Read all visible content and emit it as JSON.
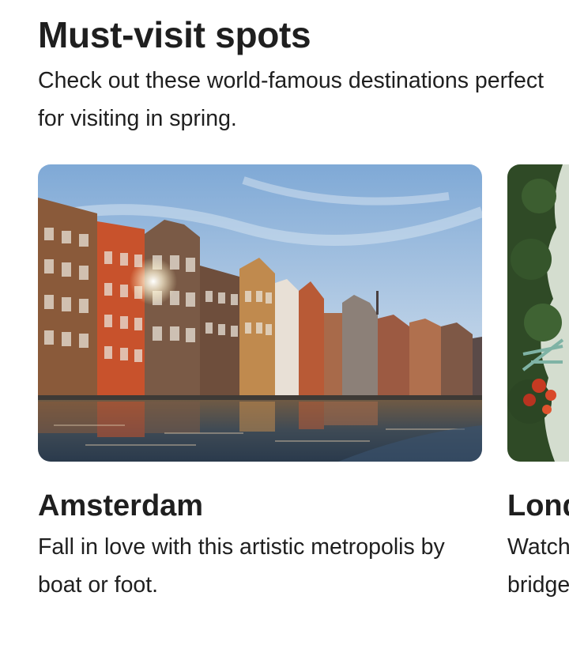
{
  "section": {
    "title": "Must-visit spots",
    "subtitle": "Check out these world-famous destinations perfect for visiting in spring."
  },
  "cards": [
    {
      "title": "Amsterdam",
      "description": "Fall in love with this artistic metropolis by boat or foot.",
      "image": "amsterdam-canal-houses-photo"
    },
    {
      "title": "London",
      "description": "Watch the world go by from the city's bridges and gardens.",
      "image": "london-bridge-through-foliage-photo"
    }
  ],
  "colors": {
    "text": "#1f1f1f",
    "background": "#ffffff"
  }
}
